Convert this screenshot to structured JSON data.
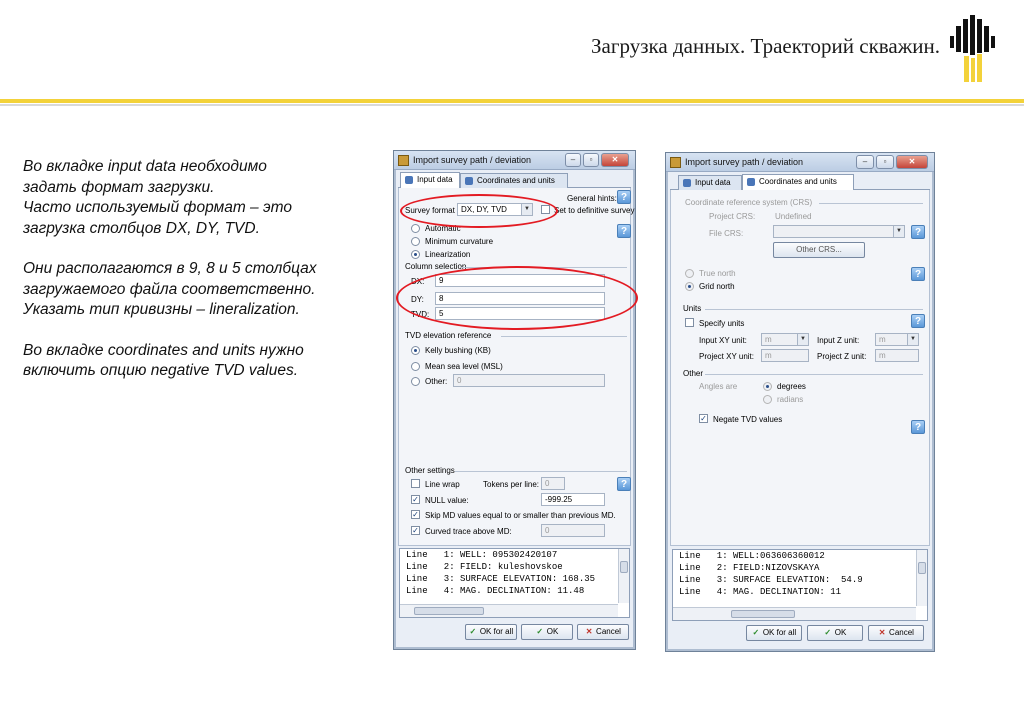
{
  "slide": {
    "title": "Загрузка данных. Траекторий скважин.",
    "paragraphs": [
      "Во вкладке input data необходимо\nзадать формат загрузки.\nЧасто используемый формат – это\nзагрузка столбцов DX, DY, TVD.",
      "Они располагаются в 9, 8 и 5 столбцах\nзагружаемого файла соответственно.\nУказать тип кривизны – lineralization.",
      "Во вкладке coordinates and units нужно\nвключить опцию negative TVD values."
    ],
    "colors": {
      "accent_yellow": "#f3d23a",
      "highlight_red": "#e31b23"
    }
  },
  "dialog1": {
    "title": "Import survey path / deviation",
    "tabs": [
      "Input data",
      "Coordinates and units"
    ],
    "general_hints": "General hints:",
    "survey_format_label": "Survey format",
    "survey_format_value": "DX, DY, TVD",
    "set_definitive": "Set to definitive survey",
    "methods": [
      "Automatic",
      "Minimum curvature",
      "Linearization"
    ],
    "column_selection": "Column selection",
    "columns": [
      {
        "label": "DX:",
        "value": "9"
      },
      {
        "label": "DY:",
        "value": "8"
      },
      {
        "label": "TVD:",
        "value": "5"
      }
    ],
    "tvd_ref_title": "TVD elevation reference",
    "tvd_refs": [
      "Kelly bushing (KB)",
      "Mean sea level (MSL)",
      "Other:"
    ],
    "other_value": "0",
    "other_settings": "Other settings",
    "line_wrap": "Line wrap",
    "tokens_per_line": "Tokens per line:",
    "tokens_value": "0",
    "null_value_label": "NULL value:",
    "null_value": "-999.25",
    "skip_md": "Skip MD values equal to or smaller than previous MD.",
    "curved_trace": "Curved trace above MD:",
    "curved_value": "0",
    "preview_lines": [
      "Line   1: WELL: 095302420107",
      "Line   2: FIELD: kuleshovskoe",
      "Line   3: SURFACE ELEVATION: 168.35",
      "Line   4: MAG. DECLINATION: 11.48"
    ],
    "buttons": [
      "OK for all",
      "OK",
      "Cancel"
    ]
  },
  "dialog2": {
    "title": "Import survey path / deviation",
    "tabs": [
      "Input data",
      "Coordinates and units"
    ],
    "crs_title": "Coordinate reference system (CRS)",
    "project_crs_label": "Project CRS:",
    "project_crs_value": "Undefined",
    "file_crs_label": "File CRS:",
    "other_crs_button": "Other CRS...",
    "north": [
      "True north",
      "Grid north"
    ],
    "units_title": "Units",
    "specify_units": "Specify units",
    "input_xy_label": "Input XY unit:",
    "input_xy_value": "m",
    "input_z_label": "Input Z unit:",
    "input_z_value": "m",
    "project_xy_label": "Project XY unit:",
    "project_xy_value": "m",
    "project_z_label": "Project Z unit:",
    "project_z_value": "m",
    "other_title": "Other",
    "angles_label": "Angles are",
    "angles": [
      "degrees",
      "radians"
    ],
    "negate_tvd": "Negate TVD values",
    "preview_lines": [
      "Line   1: WELL:063606360012",
      "Line   2: FIELD:NIZOVSKAYA",
      "Line   3: SURFACE ELEVATION:  54.9",
      "Line   4: MAG. DECLINATION: 11"
    ],
    "buttons": [
      "OK for all",
      "OK",
      "Cancel"
    ]
  }
}
